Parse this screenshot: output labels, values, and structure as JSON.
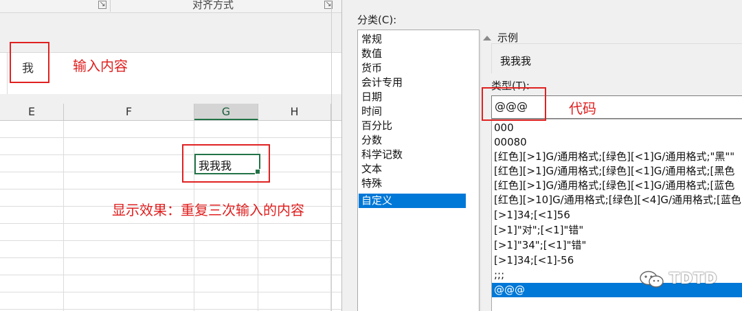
{
  "excel": {
    "ribbon": {
      "group_label": "对齐方式"
    },
    "formula_bar": {
      "value": "我"
    },
    "columns": [
      "E",
      "F",
      "G",
      "H"
    ],
    "selected_column": "G",
    "active_cell_value": "我我我"
  },
  "annotations": {
    "input_label": "输入内容",
    "result_label": "显示效果：重复三次输入的内容",
    "code_label": "代码",
    "color": "#e02020"
  },
  "dialog": {
    "category_label": "分类(C):",
    "categories": [
      "常规",
      "数值",
      "货币",
      "会计专用",
      "日期",
      "时间",
      "百分比",
      "分数",
      "科学记数",
      "文本",
      "特殊",
      "自定义"
    ],
    "selected_category": "自定义",
    "sample_label": "示例",
    "sample_value": "我我我",
    "type_label": "类型(T):",
    "type_value": "@@@",
    "type_list": [
      "000",
      "00080",
      "[红色][>1]G/通用格式;[绿色][<1]G/通用格式;\"黑\"\"",
      "[红色][>1]G/通用格式;[绿色][<1]G/通用格式;[黑色",
      "[红色][>1]G/通用格式;[绿色][<1]G/通用格式;[蓝色",
      "[红色][>10]G/通用格式;[绿色][<4]G/通用格式;[蓝色",
      "[>1]34;[<1]56",
      "[>1]\"对\";[<1]\"错\"",
      "[>1]\"34\";[<1]\"错\"",
      "[>1]34;[<1]-56",
      ";;;",
      "@@@"
    ],
    "selected_type": "@@@",
    "accent_color": "#0078d7"
  },
  "watermark": {
    "text": "TDTD",
    "icon": "wechat-icon"
  }
}
